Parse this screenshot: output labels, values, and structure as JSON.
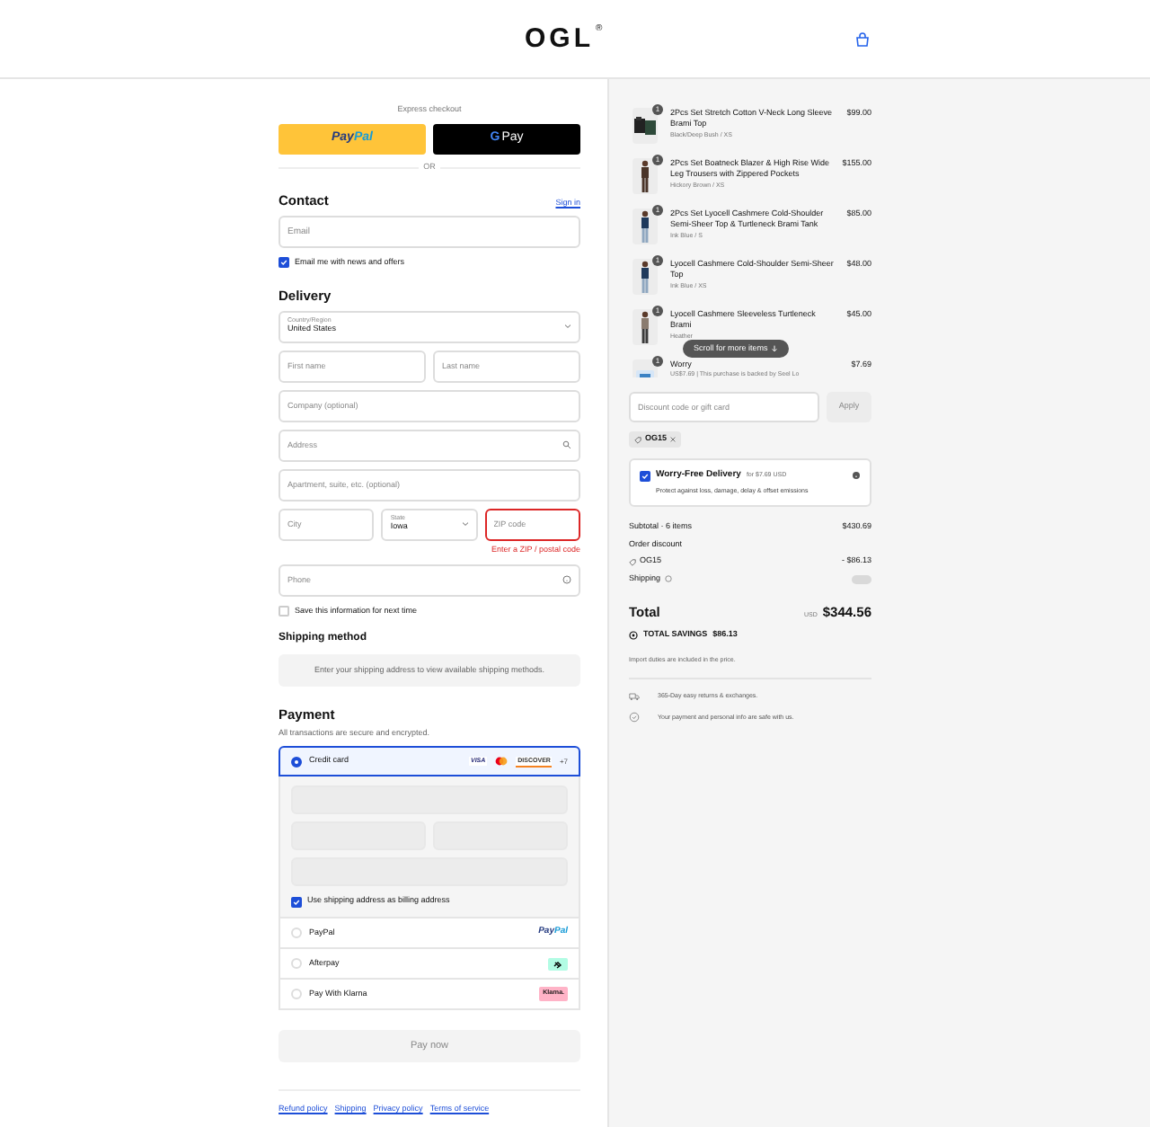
{
  "header": {
    "logo": "OGL",
    "logo_mark": "®"
  },
  "express": {
    "label": "Express checkout",
    "buttons": [
      {
        "kind": "paypal",
        "first": "Pay",
        "second": "Pal"
      },
      {
        "kind": "gpay",
        "first": "G",
        "second": "Pay"
      }
    ],
    "separator": "OR"
  },
  "contact": {
    "title": "Contact",
    "link": "Sign in",
    "email": {
      "placeholder": "Email"
    },
    "newsletter": {
      "label": "Email me with news and offers",
      "checked": true
    }
  },
  "delivery": {
    "title": "Delivery",
    "rows": [
      [
        {
          "kind": "select",
          "label": "Country/Region",
          "value": "United States"
        }
      ],
      [
        {
          "kind": "text",
          "placeholder": "First name"
        },
        {
          "kind": "text",
          "placeholder": "Last name"
        }
      ],
      [
        {
          "kind": "text",
          "placeholder": "Company (optional)"
        }
      ],
      [
        {
          "kind": "search",
          "placeholder": "Address"
        }
      ],
      [
        {
          "kind": "text",
          "placeholder": "Apartment, suite, etc. (optional)"
        }
      ],
      [
        {
          "kind": "text",
          "placeholder": "City"
        },
        {
          "kind": "select",
          "label": "State",
          "value": "Iowa"
        },
        {
          "kind": "text",
          "placeholder": "ZIP code",
          "invalid": true,
          "error": "Enter a ZIP / postal code"
        }
      ],
      [
        {
          "kind": "help",
          "placeholder": "Phone"
        }
      ]
    ],
    "save_info": {
      "label": "Save this information for next time",
      "checked": false
    }
  },
  "shipping_method": {
    "title": "Shipping method",
    "message": "Enter your shipping address to view available shipping methods."
  },
  "payment": {
    "title": "Payment",
    "subtitle": "All transactions are secure and encrypted.",
    "methods": [
      {
        "kind": "card",
        "label": "Credit card",
        "selected": true,
        "brands": [
          {
            "kind": "visa",
            "label": "VISA"
          },
          {
            "kind": "mastercard"
          },
          {
            "kind": "discover",
            "label": "DISCOVER"
          },
          {
            "kind": "more",
            "label": "+7"
          }
        ],
        "billing": {
          "label": "Use shipping address as billing address",
          "checked": true
        }
      },
      {
        "kind": "paypal",
        "label": "PayPal",
        "selected": false,
        "logo_first": "Pay",
        "logo_second": "Pal"
      },
      {
        "kind": "afterpay",
        "label": "Afterpay",
        "selected": false
      },
      {
        "kind": "klarna",
        "label": "Pay With Klarna",
        "selected": false,
        "logo": "Klarna."
      }
    ],
    "pay_button": "Pay now",
    "pay_disabled": true
  },
  "footer_links": [
    "Refund policy",
    "Shipping",
    "Privacy policy",
    "Terms of service"
  ],
  "summary": {
    "items": [
      {
        "kind": "flatlay",
        "quantity": "1",
        "name": "2Pcs Set Stretch Cotton V-Neck Long Sleeve Brami Top",
        "variant": "Black/Deep Bush / XS",
        "price": "$99.00"
      },
      {
        "kind": "brown",
        "quantity": "1",
        "name": "2Pcs Set Boatneck Blazer & High Rise Wide Leg Trousers with Zippered Pockets",
        "variant": "Hickory Brown / XS",
        "price": "$155.00"
      },
      {
        "kind": "blue",
        "quantity": "1",
        "name": "2Pcs Set Lyocell Cashmere Cold-Shoulder Semi-Sheer Top & Turtleneck Brami Tank",
        "variant": "Ink Blue / S",
        "price": "$85.00"
      },
      {
        "kind": "blue",
        "quantity": "1",
        "name": "Lyocell Cashmere Cold-Shoulder Semi-Sheer Top",
        "variant": "Ink Blue / XS",
        "price": "$48.00"
      },
      {
        "kind": "grey",
        "quantity": "1",
        "name": "Lyocell Cashmere Sleeveless Turtleneck Brami",
        "variant": "Heather",
        "price": "$45.00"
      },
      {
        "kind": "protection",
        "quantity": "1",
        "name": "Worry",
        "variant": "US$7.69 | This purchase is backed by Seel Lo",
        "price": "$7.69"
      }
    ],
    "scroll_hint": "Scroll for more items",
    "discount": {
      "placeholder": "Discount code or gift card",
      "button": "Apply"
    },
    "applied_code": "OG15",
    "protection": {
      "checked": true,
      "title": "Worry-Free Delivery",
      "price": "for $7.69 USD",
      "description": "Protect against loss, damage, delay & offset emissions"
    },
    "subtotal": {
      "label": "Subtotal · 6 items",
      "value": "$430.69"
    },
    "discount_row": {
      "label": "Order discount",
      "code": "OG15",
      "value": "- $86.13"
    },
    "shipping": {
      "label": "Shipping"
    },
    "total": {
      "label": "Total",
      "currency": "USD",
      "value": "$344.56"
    },
    "savings": {
      "label": "TOTAL SAVINGS",
      "value": "$86.13"
    },
    "note": "Import duties are included in the price.",
    "assurances": [
      {
        "kind": "returns",
        "text": "365-Day easy returns & exchanges."
      },
      {
        "kind": "secure",
        "text": "Your payment and personal info are safe with us."
      }
    ]
  }
}
